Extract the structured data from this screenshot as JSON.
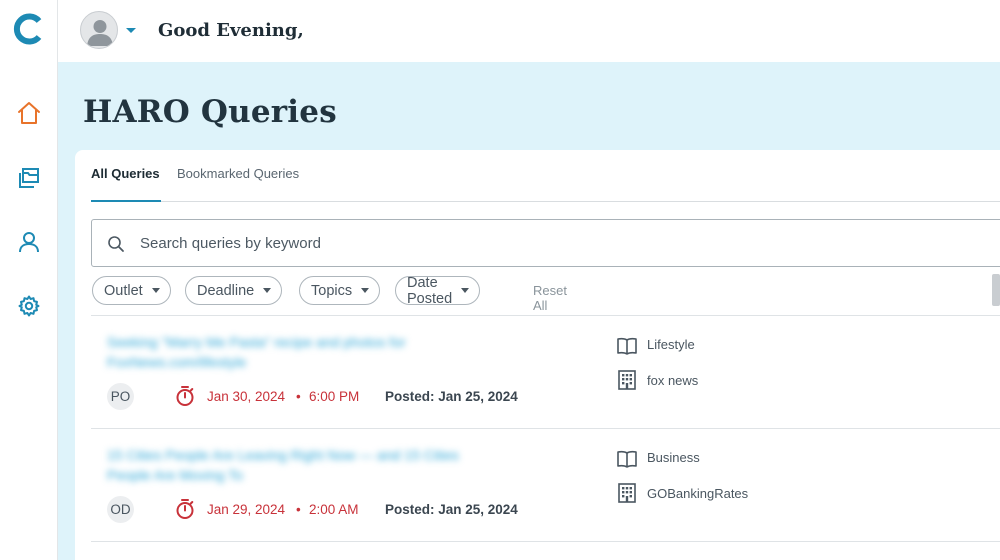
{
  "header": {
    "greeting": "Good Evening,"
  },
  "sidebar": {
    "items": [
      {
        "name": "home-icon"
      },
      {
        "name": "folders-icon"
      },
      {
        "name": "user-icon"
      },
      {
        "name": "gear-icon"
      }
    ]
  },
  "colors": {
    "brand": "#1d8ab4",
    "home_active": "#e8732a",
    "deadline": "#c8323a",
    "headline_link": "#2ba5d6",
    "page_bg": "#def3fa"
  },
  "page": {
    "title": "HARO Queries"
  },
  "tabs": [
    {
      "label": "All Queries",
      "active": true
    },
    {
      "label": "Bookmarked Queries",
      "active": false
    }
  ],
  "search": {
    "placeholder": "Search queries by keyword",
    "value": ""
  },
  "filters": {
    "chips": [
      "Outlet",
      "Deadline",
      "Topics",
      "Date Posted"
    ],
    "reset_label": "Reset All"
  },
  "queries": [
    {
      "headline": "Seeking \"Marry Me Pasta\" recipe and photos for FoxNews.com/lifestyle",
      "initials": "PO",
      "deadline_date": "Jan 30, 2024",
      "separator": "•",
      "deadline_time": "6:00 PM",
      "posted": "Posted: Jan 25, 2024",
      "category": "Lifestyle",
      "outlet": "fox news"
    },
    {
      "headline": "15 Cities People Are Leaving Right Now — and 15 Cities People Are Moving To",
      "initials": "OD",
      "deadline_date": "Jan 29, 2024",
      "separator": "•",
      "deadline_time": "2:00 AM",
      "posted": "Posted: Jan 25, 2024",
      "category": "Business",
      "outlet": "GOBankingRates"
    }
  ]
}
